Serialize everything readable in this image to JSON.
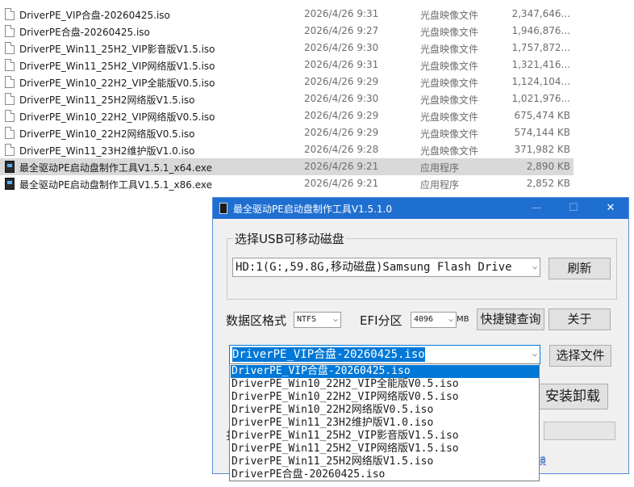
{
  "files": [
    {
      "name": "DriverPE_VIP合盘-20260425.iso",
      "date": "2026/4/26 9:31",
      "type": "光盘映像文件",
      "size": "2,347,646...",
      "icon": "disc-image-icon"
    },
    {
      "name": "DriverPE合盘-20260425.iso",
      "date": "2026/4/26 9:27",
      "type": "光盘映像文件",
      "size": "1,946,876...",
      "icon": "disc-image-icon"
    },
    {
      "name": "DriverPE_Win11_25H2_VIP影音版V1.5.iso",
      "date": "2026/4/26 9:30",
      "type": "光盘映像文件",
      "size": "1,757,872...",
      "icon": "disc-image-icon"
    },
    {
      "name": "DriverPE_Win11_25H2_VIP网络版V1.5.iso",
      "date": "2026/4/26 9:31",
      "type": "光盘映像文件",
      "size": "1,321,416...",
      "icon": "disc-image-icon"
    },
    {
      "name": "DriverPE_Win10_22H2_VIP全能版V0.5.iso",
      "date": "2026/4/26 9:29",
      "type": "光盘映像文件",
      "size": "1,124,104...",
      "icon": "disc-image-icon"
    },
    {
      "name": "DriverPE_Win11_25H2网络版V1.5.iso",
      "date": "2026/4/26 9:30",
      "type": "光盘映像文件",
      "size": "1,021,976...",
      "icon": "disc-image-icon"
    },
    {
      "name": "DriverPE_Win10_22H2_VIP网络版V0.5.iso",
      "date": "2026/4/26 9:29",
      "type": "光盘映像文件",
      "size": "675,474 KB",
      "icon": "disc-image-icon"
    },
    {
      "name": "DriverPE_Win10_22H2网络版V0.5.iso",
      "date": "2026/4/26 9:29",
      "type": "光盘映像文件",
      "size": "574,144 KB",
      "icon": "disc-image-icon"
    },
    {
      "name": "DriverPE_Win11_23H2维护版V1.0.iso",
      "date": "2026/4/26 9:28",
      "type": "光盘映像文件",
      "size": "371,982 KB",
      "icon": "disc-image-icon"
    },
    {
      "name": "最全驱动PE启动盘制作工具V1.5.1_x64.exe",
      "date": "2026/4/26 9:21",
      "type": "应用程序",
      "size": "2,890 KB",
      "icon": "exe-icon",
      "selected": true
    },
    {
      "name": "最全驱动PE启动盘制作工具V1.5.1_x86.exe",
      "date": "2026/4/26 9:21",
      "type": "应用程序",
      "size": "2,852 KB",
      "icon": "exe-icon"
    }
  ],
  "dialog": {
    "title": "最全驱动PE启动盘制作工具V1.5.1.0",
    "min_glyph": "—",
    "max_glyph": "☐",
    "close_glyph": "✕",
    "usb_group_label": "选择USB可移动磁盘",
    "usb_drive": "HD:1(G:,59.8G,移动磁盘)Samsung Flash Drive",
    "refresh_button": "刷新",
    "data_format_label": "数据区格式",
    "data_format_value": "NTFS",
    "efi_label": "EFI分区",
    "efi_value": "4096",
    "efi_unit": "MB",
    "hotkey_button": "快捷键查询",
    "about_button": "关于",
    "iso_selected": "DriverPE_VIP合盘-20260425.iso",
    "choose_file_button": "选择文件",
    "install_uninstall_button": "安装卸载",
    "partial_left_text": "扌",
    "partial_link_text": "镜"
  },
  "dropdown_items": [
    "DriverPE_VIP合盘-20260425.iso",
    "DriverPE_Win10_22H2_VIP全能版V0.5.iso",
    "DriverPE_Win10_22H2_VIP网络版V0.5.iso",
    "DriverPE_Win10_22H2网络版V0.5.iso",
    "DriverPE_Win11_23H2维护版V1.0.iso",
    "DriverPE_Win11_25H2_VIP影音版V1.5.iso",
    "DriverPE_Win11_25H2_VIP网络版V1.5.iso",
    "DriverPE_Win11_25H2网络版V1.5.iso",
    "DriverPE合盘-20260425.iso"
  ],
  "dropdown_highlighted_index": 0,
  "colors": {
    "titlebar": "#1f6fd1",
    "highlight": "#0078d7",
    "selected_row": "#d9d9d9"
  }
}
